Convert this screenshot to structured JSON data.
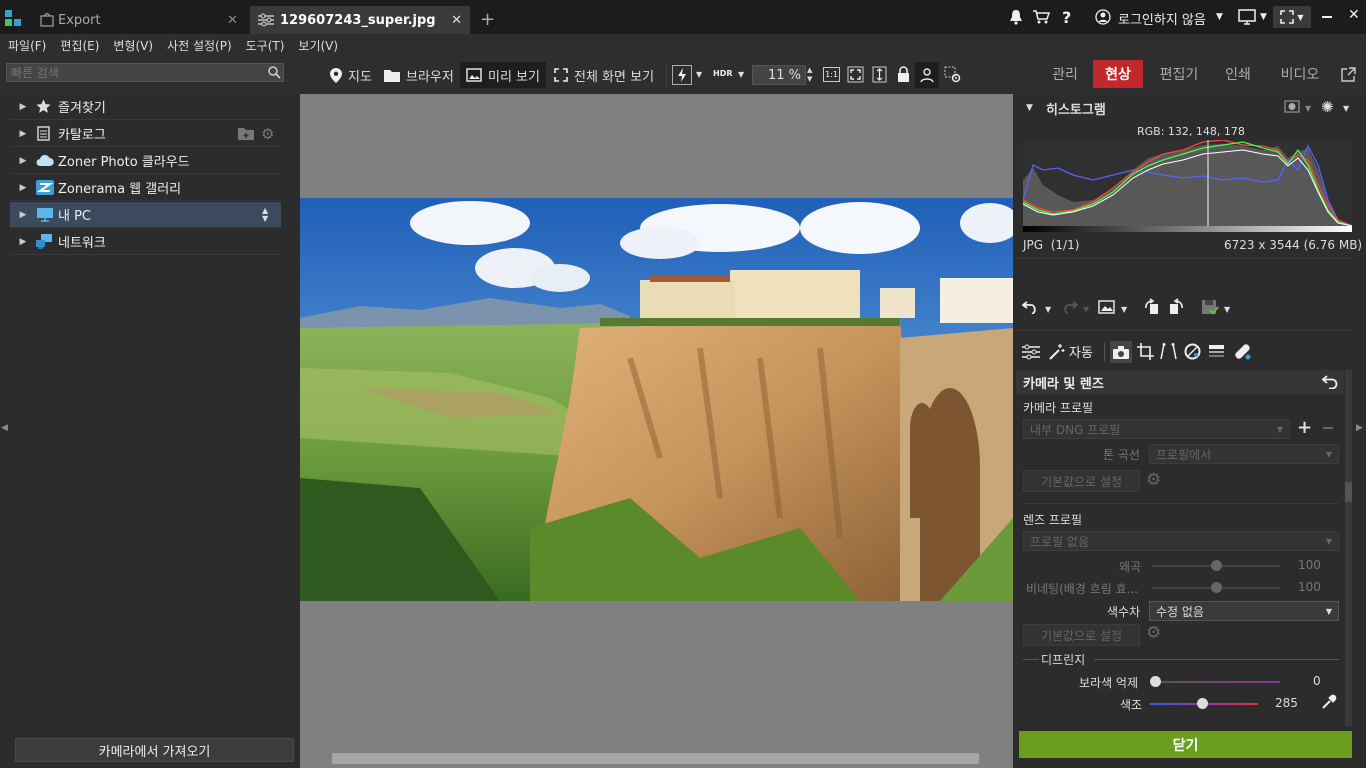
{
  "tabs": [
    {
      "label": "Export",
      "close": "✕"
    },
    {
      "label": "129607243_super.jpg",
      "close": "✕"
    }
  ],
  "new_tab": "+",
  "account": {
    "label": "로그인하지 않음"
  },
  "menu": [
    "파일(F)",
    "편집(E)",
    "변형(V)",
    "사전 설정(P)",
    "도구(T)",
    "보기(V)"
  ],
  "search": {
    "placeholder": "빠른 검색",
    "value": ""
  },
  "toolbar": {
    "map": "지도",
    "browser": "브라우저",
    "preview": "미리 보기",
    "fullscreen": "전체 화면 보기",
    "hdr": "HDR",
    "zoom": "11 %",
    "ratio": "1:1"
  },
  "modes": [
    "관리",
    "현상",
    "편집기",
    "인쇄",
    "비디오"
  ],
  "active_mode": "현상",
  "nav": [
    {
      "label": "즐겨찾기",
      "icon": "star-icon"
    },
    {
      "label": "카탈로그",
      "icon": "catalog-icon"
    },
    {
      "label": "Zoner Photo 클라우드",
      "icon": "cloud-icon"
    },
    {
      "label": "Zonerama 웹 갤러리",
      "icon": "zonerama-icon"
    },
    {
      "label": "내 PC",
      "icon": "computer-icon"
    },
    {
      "label": "네트워크",
      "icon": "network-icon"
    }
  ],
  "import_button": "카메라에서 가져오기",
  "histogram": {
    "title": "히스토그램",
    "rgb": "RGB: 132, 148, 178",
    "format": "JPG  (1/1)",
    "dimensions": "6723 x 3544 (6.76 MB)"
  },
  "tool_tabs": {
    "auto": "자동"
  },
  "section": {
    "title": "카메라 및 렌즈"
  },
  "camera": {
    "profile_label": "카메라 프로필",
    "profile_value": "내부 DNG 프로필",
    "tone_label": "톤 곡선",
    "tone_value": "프로필에서",
    "reset": "기본값으로 설정"
  },
  "lens": {
    "profile_label": "렌즈 프로필",
    "profile_value": "프로필 없음",
    "distortion_label": "왜곡",
    "distortion_value": "100",
    "distortion_level": 0.5,
    "vignette_label": "비네팅(배경 흐림 효...",
    "vignette_value": "100",
    "vignette_level": 0.5,
    "ca_label": "색수차",
    "ca_value": "수정 없음",
    "reset": "기본값으로 설정"
  },
  "defringe": {
    "title": "디프린지",
    "purple_label": "보라색 억제",
    "purple_value": "0",
    "purple_level": 0,
    "hue_label": "색조",
    "hue_value": "285"
  },
  "close_button": "닫기",
  "colors": {
    "accent_red": "#c0282c",
    "close_green": "#6a9e1f",
    "selected_nav": "#3b4a5c"
  }
}
